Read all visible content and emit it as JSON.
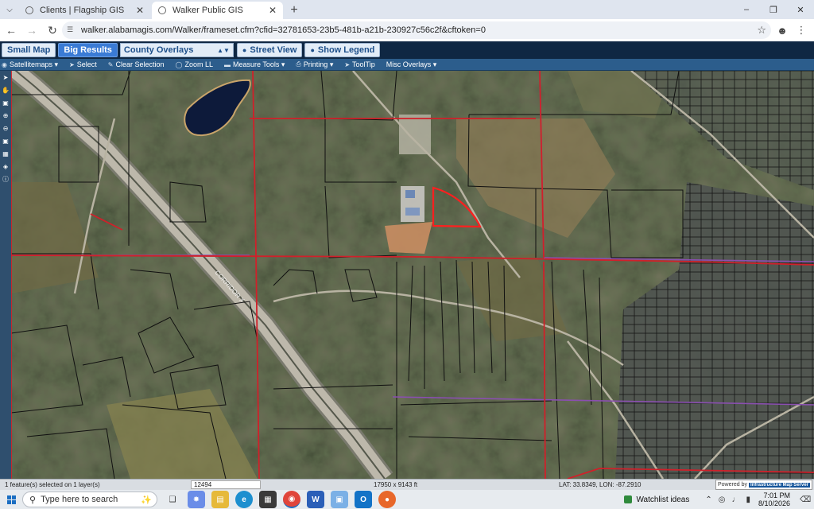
{
  "browser": {
    "tabs": [
      {
        "title": "Clients | Flagship GIS",
        "active": false
      },
      {
        "title": "Walker Public GIS",
        "active": true
      }
    ],
    "url": "walker.alabamagis.com/Walker/frameset.cfm?cfid=32781653-23b5-481b-a21b-230927c56c2f&cftoken=0",
    "icons": {
      "tab_menu": "chevron-down-icon",
      "new_tab": "plus-icon",
      "back": "back-arrow-icon",
      "forward": "forward-arrow-icon",
      "reload": "reload-icon",
      "bookmark": "star-icon",
      "profile": "profile-icon",
      "menu": "kebab-menu-icon"
    }
  },
  "gis_header": {
    "small_map": "Small Map",
    "big_results": "Big Results",
    "county_overlays": "County Overlays",
    "street_view": "Street View",
    "show_legend": "Show Legend"
  },
  "toolbar": {
    "satellitemaps": "Satellitemaps",
    "select": "Select",
    "clear_selection": "Clear Selection",
    "zoom_ll": "Zoom LL",
    "measure_tools": "Measure Tools",
    "printing": "Printing",
    "tooltip": "ToolTip",
    "misc_overlays": "Misc Overlays"
  },
  "map": {
    "road_label": "CORRIDOR X",
    "colors": {
      "parcel": "#111111",
      "boundary": "#d0202a",
      "district": "#8a4fb0",
      "highway": "#b9b4a8"
    }
  },
  "status": {
    "selection": "1 feature(s) selected on 1 layer(s)",
    "scale": "12494",
    "extent": "17950 x 9143 ft",
    "latlon": "LAT: 33.8349, LON: -87.2910",
    "powered_by": "Powered by",
    "powered_brand": "Infrastructure Map Server"
  },
  "taskbar": {
    "search_placeholder": "Type here to search",
    "watchlist": "Watchlist ideas",
    "time": "7:01 PM",
    "date": "8/10/2026",
    "apps": [
      "task-view-icon",
      "copilot-icon",
      "file-explorer-icon",
      "edge-icon",
      "store-icon",
      "chrome-icon",
      "word-icon",
      "photos-icon",
      "outlook-icon",
      "firefox-icon"
    ]
  }
}
